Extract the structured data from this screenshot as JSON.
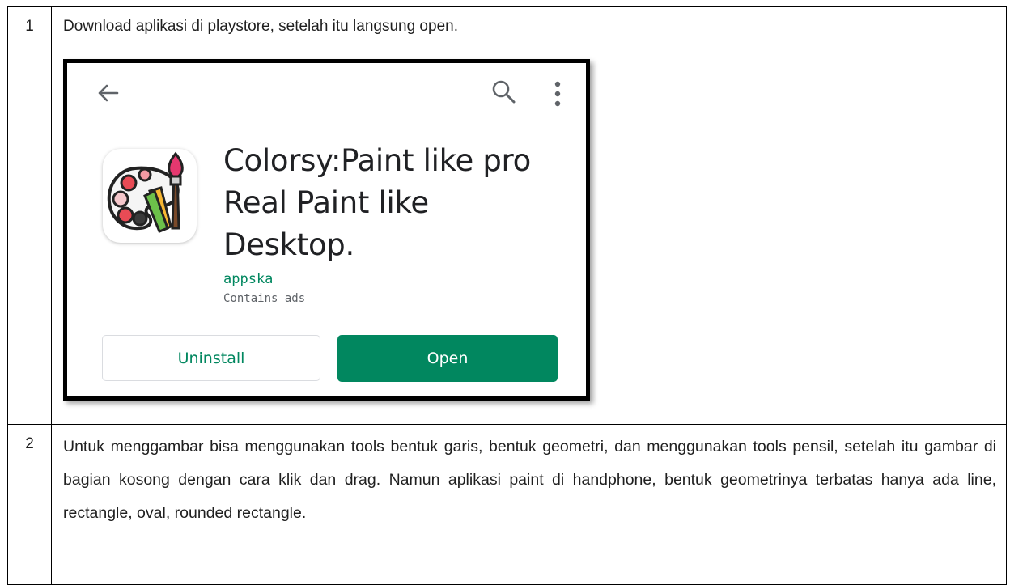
{
  "steps": [
    {
      "number": "1",
      "text": "Download aplikasi di playstore, setelah itu langsung open."
    },
    {
      "number": "2",
      "text": "Untuk menggambar bisa menggunakan tools bentuk garis, bentuk geometri, dan menggunakan tools pensil, setelah itu gambar di bagian kosong dengan cara klik dan drag.  Namun aplikasi paint di handphone, bentuk geometrinya terbatas hanya ada line, rectangle, oval, rounded rectangle."
    }
  ],
  "store_screenshot": {
    "app_title": "Colorsy:Paint like pro Real Paint like Desktop.",
    "developer": "appska",
    "ads_note": "Contains ads",
    "uninstall_label": "Uninstall",
    "open_label": "Open",
    "icons": {
      "back": "arrow-back-icon",
      "search": "search-icon",
      "more": "more-vert-icon",
      "app": "palette-brush-app-icon"
    },
    "colors": {
      "accent_green": "#01875f",
      "title_text": "#202124",
      "secondary_text": "#5f6368"
    }
  }
}
